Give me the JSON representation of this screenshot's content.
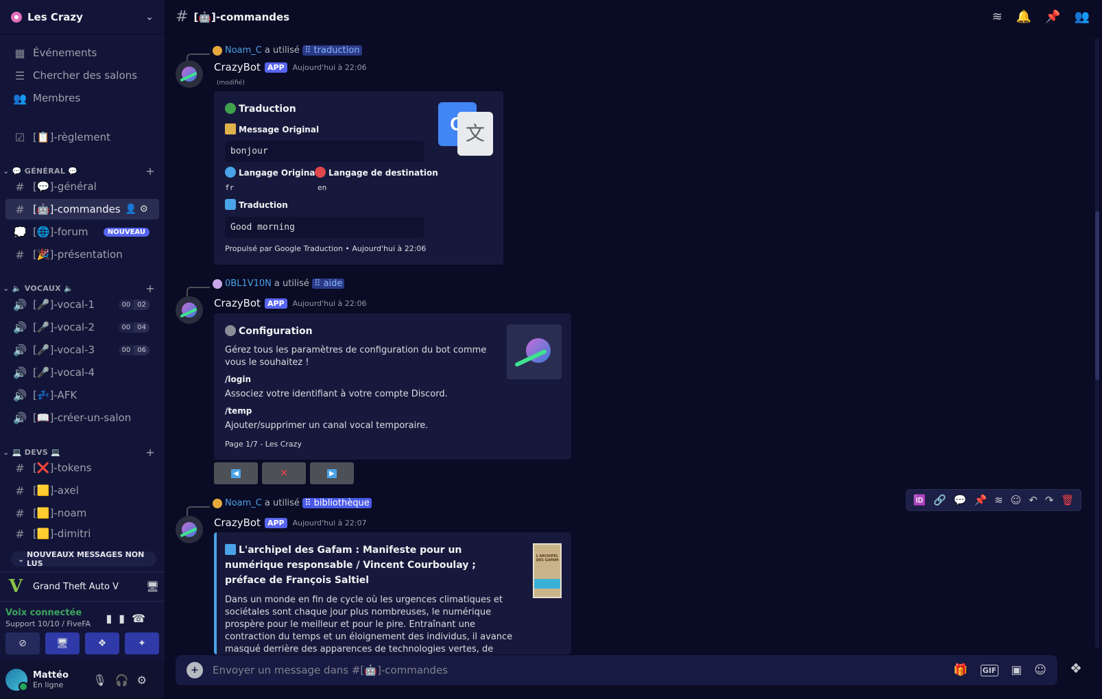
{
  "server": {
    "name": "Les Crazy"
  },
  "nav": {
    "events": "Événements",
    "browse": "Chercher des salons",
    "members": "Membres",
    "rules": "[📋]-règlement"
  },
  "categories": {
    "general": "GÉNÉRAL",
    "vocaux": "VOCAUX",
    "devs": "DEVS"
  },
  "channels": {
    "general": "[💬]-général",
    "commandes": "[🤖]-commandes",
    "forum": "[🌐]-forum",
    "forum_badge": "NOUVEAU",
    "presentation": "[🎉]-présentation",
    "vocal1": "[🎤]-vocal-1",
    "vocal1_counts": [
      "00",
      "02"
    ],
    "vocal2": "[🎤]-vocal-2",
    "vocal2_counts": [
      "00",
      "04"
    ],
    "vocal3": "[🎤]-vocal-3",
    "vocal3_counts": [
      "00",
      "06"
    ],
    "vocal4": "[🎤]-vocal-4",
    "afk": "[💤]-AFK",
    "create": "[📖]-créer-un-salon",
    "tokens": "[❌]-tokens",
    "axel": "[🟨]-axel",
    "noam": "[🟨]-noam",
    "dimitri": "[🟨]-dimitri"
  },
  "unread_pill": "NOUVEAUX MESSAGES NON LUS",
  "activity": {
    "name": "Grand Theft Auto V"
  },
  "voice": {
    "title": "Voix connectée",
    "sub": "Support 10/10 / FiveFA"
  },
  "user": {
    "name": "Mattéo",
    "status": "En ligne"
  },
  "topbar": {
    "title": "[🤖]-commandes"
  },
  "messages": [
    {
      "reply_user": "Noam_C",
      "reply_text": "a utilisé",
      "command": "traduction",
      "author": "CrazyBot",
      "tag": "APP",
      "time": "Aujourd'hui à 22:06",
      "edited": "(modifié)",
      "embed": {
        "title": "Traduction",
        "f1_name": "Message Original",
        "f1_value": "bonjour",
        "f2_name": "Langage Original",
        "f2_value": "fr",
        "f3_name": "Langage de destination",
        "f3_value": "en",
        "f4_name": "Traduction",
        "f4_value": "Good morning",
        "footer": "Propulsé par Google Traduction • Aujourd'hui à 22:06"
      }
    },
    {
      "reply_user": "0BL1V10N",
      "reply_text": "a utilisé",
      "command": "aide",
      "author": "CrazyBot",
      "tag": "APP",
      "time": "Aujourd'hui à 22:06",
      "embed": {
        "title": "Configuration",
        "desc": "Gérez tous les paramètres de configuration du bot comme vous le souhaitez !",
        "f1_name": "/login",
        "f1_value": "Associez votre identifiant à votre compte Discord.",
        "f2_name": "/temp",
        "f2_value": "Ajouter/supprimer un canal vocal temporaire.",
        "footer": "Page 1/7 - Les Crazy"
      }
    },
    {
      "reply_user": "Noam_C",
      "reply_text": "a utilisé",
      "command": "bibliothèque",
      "author": "CrazyBot",
      "tag": "APP",
      "time": "Aujourd'hui à 22:07",
      "embed": {
        "title": "L'archipel des Gafam  : Manifeste pour un numérique responsable / Vincent Courboulay ; préface de François Saltiel",
        "desc": "Dans un monde en fin de cycle où les urgences climatiques et sociétales sont chaque jour plus nombreuses, le numérique prospère pour le meilleur et pour le pire. Entraînant une contraction du temps et un éloignement des individus, il avance masqué derrière des apparences de technologies vertes, de progrès et de prospérité, pour",
        "cover": "L'ARCHIPEL DES GAFAM"
      }
    }
  ],
  "composer": {
    "placeholder": "Envoyer un message dans #[🤖]-commandes"
  },
  "colors": {
    "accent": "#5865f2",
    "online": "#23a55a",
    "link": "#4ba1e6",
    "danger": "#f23f43"
  }
}
